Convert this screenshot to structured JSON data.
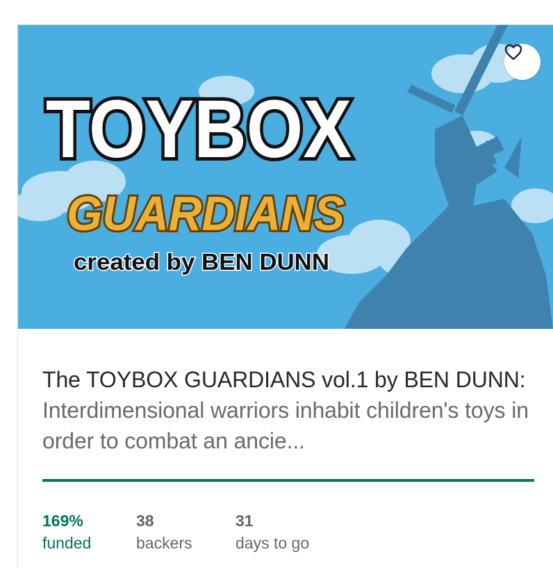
{
  "hero": {
    "logo_top": "TOYBOX",
    "logo_sub": "GUARDIANS",
    "credit": "created by BEN DUNN",
    "colors": {
      "sky": "#4aaee0",
      "silhouette": "#3f82ad",
      "gold": "#e8b23a"
    }
  },
  "favorite": {
    "icon": "heart-outline-icon"
  },
  "project": {
    "title": "The TOYBOX GUARDIANS vol.1 by BEN DUNN:",
    "blurb": "Interdimensional warriors inhabit children's toys in order to combat an ancie..."
  },
  "progress": {
    "percent": 169,
    "accent": "#037362"
  },
  "stats": {
    "funded": {
      "value": "169%",
      "label": "funded"
    },
    "backers": {
      "value": "38",
      "label": "backers"
    },
    "days": {
      "value": "31",
      "label": "days to go"
    }
  }
}
